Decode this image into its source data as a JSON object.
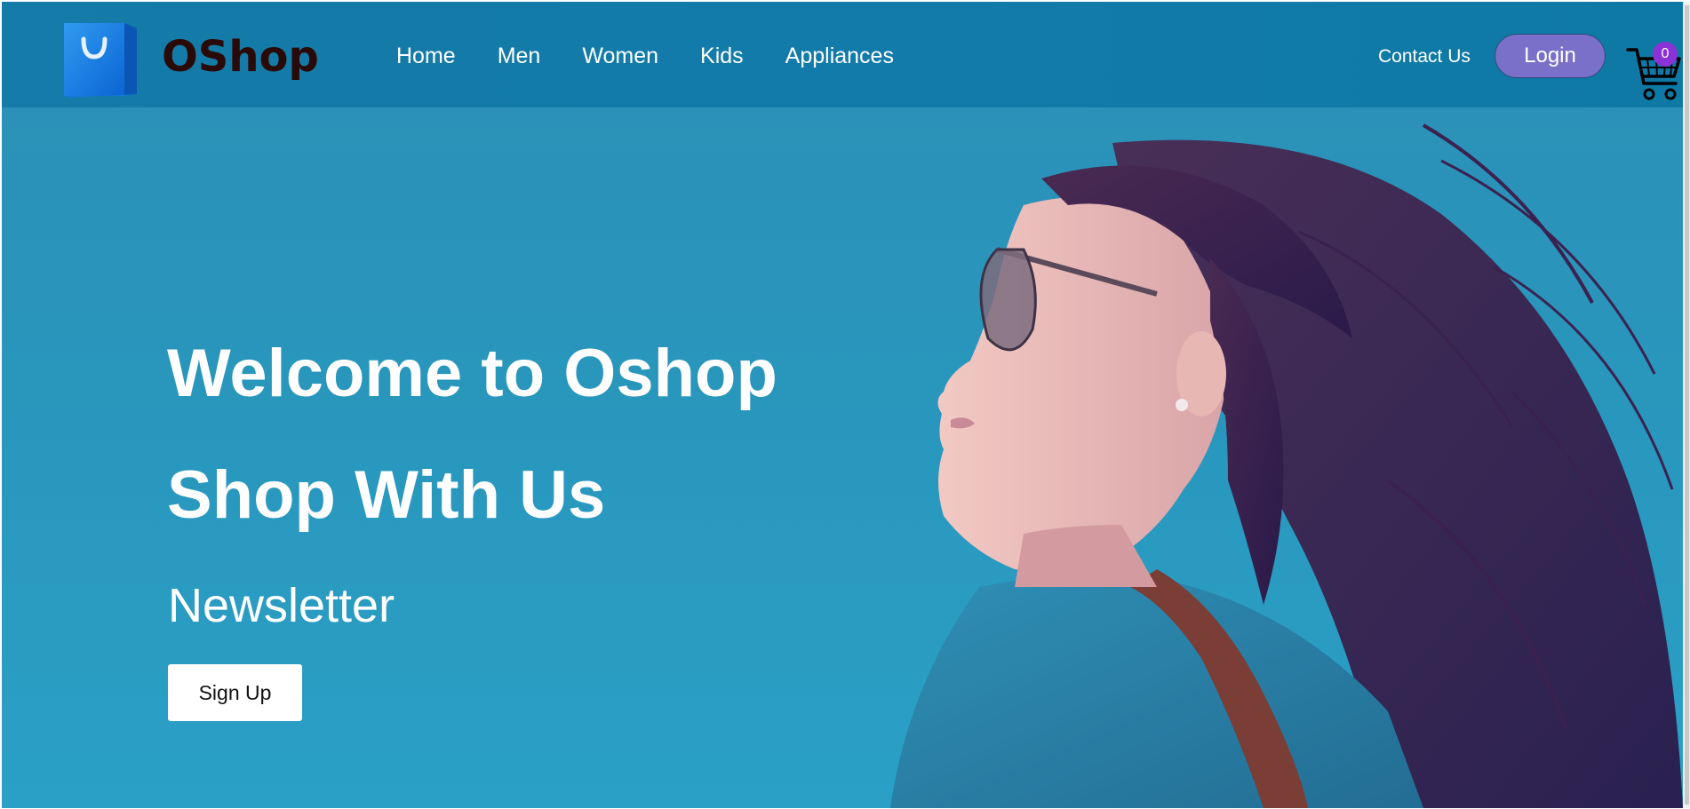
{
  "brand": {
    "name": "OShop",
    "icon": "shopping-bag-icon"
  },
  "nav": {
    "items": [
      {
        "label": "Home"
      },
      {
        "label": "Men"
      },
      {
        "label": "Women"
      },
      {
        "label": "Kids"
      },
      {
        "label": "Appliances"
      }
    ],
    "contact_label": "Contact Us",
    "login_label": "Login",
    "cart": {
      "icon": "shopping-cart-icon",
      "count": "0"
    }
  },
  "hero": {
    "title": "Welcome to Oshop",
    "tagline": "Shop With Us",
    "newsletter_label": "Newsletter",
    "signup_label": "Sign Up"
  },
  "colors": {
    "header_bg": "#127ba9",
    "hero_bg": "#2697bb",
    "login_bg": "#7a6fc9",
    "cart_badge": "#8b32d6",
    "brand_text": "#2a0a08"
  }
}
